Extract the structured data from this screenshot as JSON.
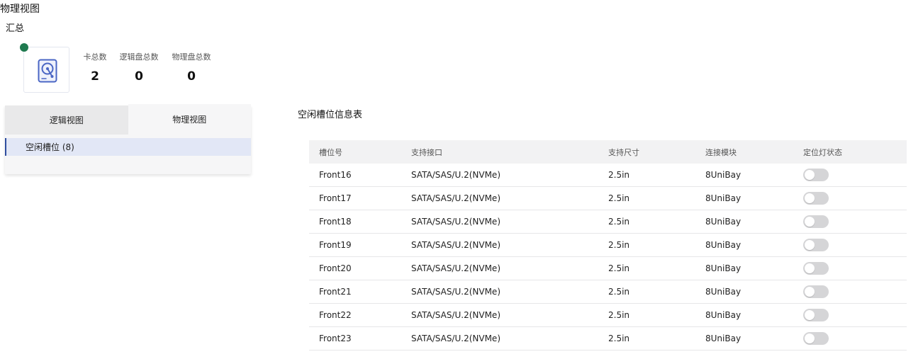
{
  "page_title": "物理视图",
  "summary": {
    "title": "汇总",
    "stats": [
      {
        "label": "卡总数",
        "value": "2"
      },
      {
        "label": "逻辑盘总数",
        "value": "0"
      },
      {
        "label": "物理盘总数",
        "value": "0"
      }
    ]
  },
  "view_tabs": [
    "逻辑视图",
    "物理视图"
  ],
  "tree": {
    "item_label": "空闲槽位 (8)"
  },
  "table": {
    "title": "空闲槽位信息表",
    "headers": [
      "槽位号",
      "支持接口",
      "支持尺寸",
      "连接模块",
      "定位灯状态"
    ],
    "rows": [
      {
        "slot": "Front16",
        "interface": "SATA/SAS/U.2(NVMe)",
        "size": "2.5in",
        "module": "8UniBay",
        "locate_light": "off"
      },
      {
        "slot": "Front17",
        "interface": "SATA/SAS/U.2(NVMe)",
        "size": "2.5in",
        "module": "8UniBay",
        "locate_light": "off"
      },
      {
        "slot": "Front18",
        "interface": "SATA/SAS/U.2(NVMe)",
        "size": "2.5in",
        "module": "8UniBay",
        "locate_light": "off"
      },
      {
        "slot": "Front19",
        "interface": "SATA/SAS/U.2(NVMe)",
        "size": "2.5in",
        "module": "8UniBay",
        "locate_light": "off"
      },
      {
        "slot": "Front20",
        "interface": "SATA/SAS/U.2(NVMe)",
        "size": "2.5in",
        "module": "8UniBay",
        "locate_light": "off"
      },
      {
        "slot": "Front21",
        "interface": "SATA/SAS/U.2(NVMe)",
        "size": "2.5in",
        "module": "8UniBay",
        "locate_light": "off"
      },
      {
        "slot": "Front22",
        "interface": "SATA/SAS/U.2(NVMe)",
        "size": "2.5in",
        "module": "8UniBay",
        "locate_light": "off"
      },
      {
        "slot": "Front23",
        "interface": "SATA/SAS/U.2(NVMe)",
        "size": "2.5in",
        "module": "8UniBay",
        "locate_light": "off"
      }
    ]
  },
  "icons": {
    "status": "status-dot-icon",
    "disk": "hard-disk-icon",
    "toggle": "toggle-switch-icon"
  },
  "colors": {
    "status_dot": "#1f7a4f",
    "selected_bg": "#e2e7f6",
    "selected_border": "#2f4e9f",
    "toggle_off": "#d5d5d7",
    "icon_blue": "#4a66c4"
  }
}
